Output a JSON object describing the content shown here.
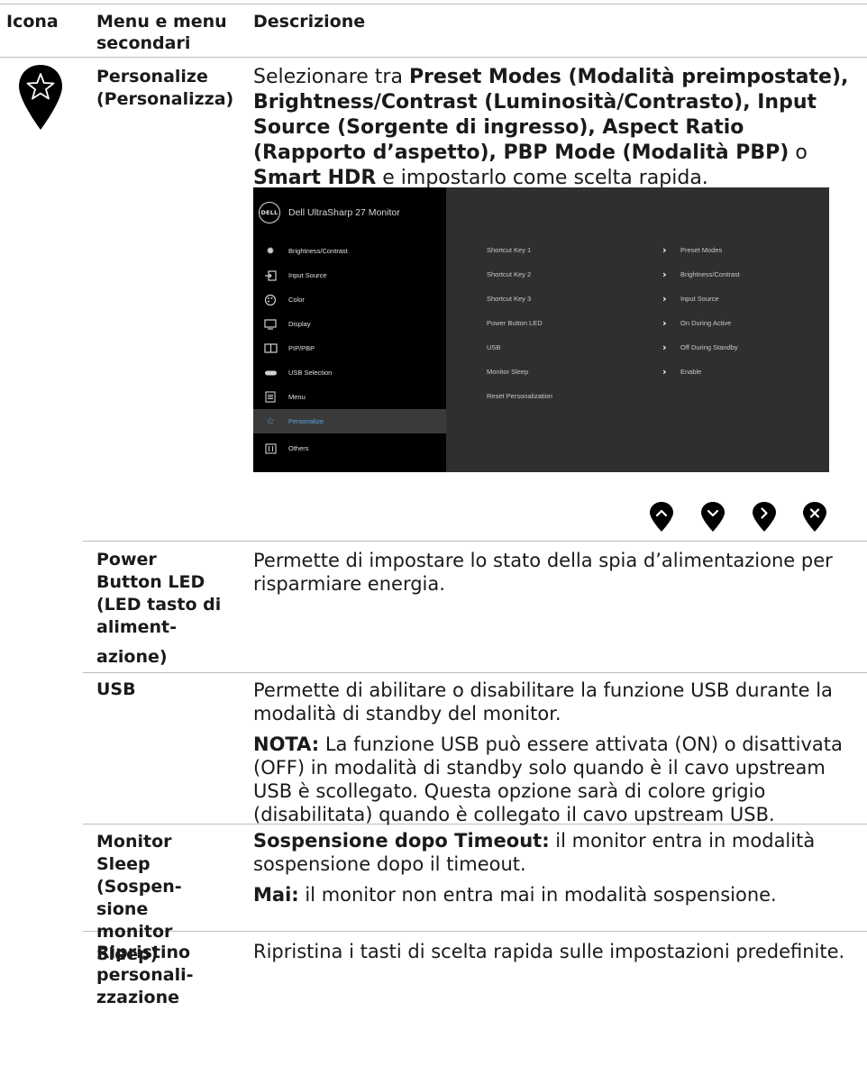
{
  "header": {
    "col_icon": "Icona",
    "col_menu_line1": "Menu e menu",
    "col_menu_line2": "secondari",
    "col_desc": "Descrizione"
  },
  "personalize": {
    "name_line1": "Personalize",
    "name_line2": "(Personalizza)",
    "desc": {
      "t1": "Selezionare tra ",
      "b1": "Preset Modes (Modalità preimpostate), Brightness/Contrast (Luminosità/Contrasto), Input Source (Sorgente di ingresso), Aspect Ratio (Rapporto d’aspetto), PBP Mode (Modalità PBP)",
      "t2": " o ",
      "b2": "Smart HDR",
      "t3": " e impostarlo come scelta rapida."
    }
  },
  "osd": {
    "logo": "DELL",
    "title": "Dell UltraSharp 27 Monitor",
    "menu": [
      {
        "label": "Brightness/Contrast",
        "icon": "sun-icon"
      },
      {
        "label": "Input Source",
        "icon": "input-icon"
      },
      {
        "label": "Color",
        "icon": "palette-icon"
      },
      {
        "label": "Display",
        "icon": "monitor-icon"
      },
      {
        "label": "PIP/PBP",
        "icon": "pip-icon"
      },
      {
        "label": "USB Selection",
        "icon": "usb-icon"
      },
      {
        "label": "Menu",
        "icon": "menu-icon"
      },
      {
        "label": "Personalize",
        "icon": "star-icon",
        "selected": true
      },
      {
        "label": "Others",
        "icon": "others-icon"
      }
    ],
    "rows": [
      {
        "key": "Shortcut Key 1",
        "value": "Preset Modes"
      },
      {
        "key": "Shortcut Key 2",
        "value": "Brightness/Contrast"
      },
      {
        "key": "Shortcut Key 3",
        "value": "Input Source"
      },
      {
        "key": "Power Button LED",
        "value": "On During Active"
      },
      {
        "key": "USB",
        "value": "Off During Standby"
      },
      {
        "key": "Monitor Sleep",
        "value": "Enable"
      },
      {
        "key": "Reset Personalization",
        "value": ""
      }
    ],
    "accent": "#5fa3e0"
  },
  "nav_buttons": [
    "chevron-up-icon",
    "chevron-down-icon",
    "chevron-right-icon",
    "close-icon"
  ],
  "power_led": {
    "name_l1": "Power",
    "name_l2": "Button LED",
    "name_l3": "(LED tasto di",
    "name_l4": "aliment-",
    "name_l5": "azione)",
    "desc": "Permette di impostare lo stato della spia d’alimentazione per risparmiare energia."
  },
  "usb": {
    "name": "USB",
    "desc": "Permette di abilitare o disabilitare la funzione USB durante la modalità di standby del monitor.",
    "note_label": "NOTA:",
    "note": " La funzione USB può essere attivata (ON) o disattivata (OFF) in modalità di standby solo quando è il cavo upstream USB è scollegato. Questa opzione sarà di colore grigio (disabilitata) quando è collegato il cavo upstream USB."
  },
  "monitor_sleep": {
    "name_l1": "Monitor",
    "name_l2": "Sleep",
    "name_l3": "(Sospen-",
    "name_l4": "sione",
    "name_l5": "monitor",
    "name_l6": "Sleep)",
    "opt1_label": "Sospensione dopo Timeout:",
    "opt1": " il monitor entra in modalità sospensione dopo il timeout.",
    "opt2_label": "Mai:",
    "opt2": " il monitor non entra mai in modalità sospensione."
  },
  "reset": {
    "name_l1": "Ripristino",
    "name_l2": "personali-",
    "name_l3": "zzazione",
    "desc": "Ripristina i tasti di scelta rapida sulle impostazioni predefinite."
  }
}
